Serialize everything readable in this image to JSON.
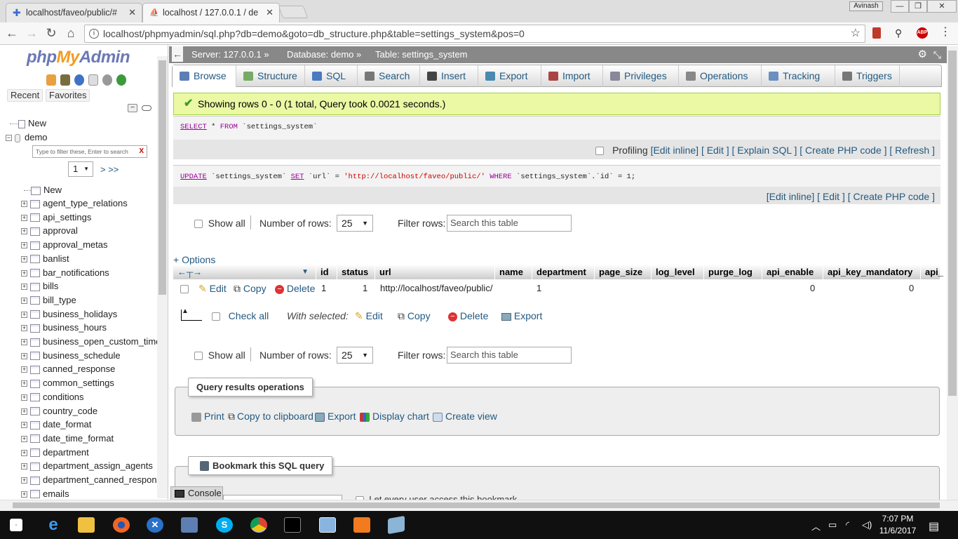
{
  "browser": {
    "tabs": [
      {
        "title": "localhost/faveo/public/#"
      },
      {
        "title": "localhost / 127.0.0.1 / de"
      }
    ],
    "user": "Avinash",
    "url": "localhost/phpmyadmin/sql.php?db=demo&goto=db_structure.php&table=settings_system&pos=0"
  },
  "sidebar": {
    "logo": {
      "php": "php",
      "my": "My",
      "admin": "Admin"
    },
    "recent": "Recent",
    "favorites": "Favorites",
    "new_root": "New",
    "db": "demo",
    "filter_placeholder": "Type to filter these, Enter to search",
    "filter_clear": "X",
    "page": "1",
    "page_next": "> >>",
    "new_table": "New",
    "tables": [
      "agent_type_relations",
      "api_settings",
      "approval",
      "approval_metas",
      "banlist",
      "bar_notifications",
      "bills",
      "bill_type",
      "business_holidays",
      "business_hours",
      "business_open_custom_time",
      "business_schedule",
      "canned_response",
      "common_settings",
      "conditions",
      "country_code",
      "date_format",
      "date_time_format",
      "department",
      "department_assign_agents",
      "department_canned_response",
      "emails"
    ]
  },
  "breadcrumb": {
    "server": "Server: 127.0.0.1",
    "database": "Database: demo",
    "table": "Table: settings_system"
  },
  "tabs": [
    "Browse",
    "Structure",
    "SQL",
    "Search",
    "Insert",
    "Export",
    "Import",
    "Privileges",
    "Operations",
    "Tracking",
    "Triggers"
  ],
  "success_message": "Showing rows 0 - 0 (1 total, Query took 0.0021 seconds.)",
  "select_query": {
    "kw1": "SELECT",
    "star": "*",
    "kw2": "FROM",
    "table": "`settings_system`"
  },
  "select_options": {
    "profiling": "Profiling",
    "edit_inline": "[Edit inline]",
    "edit": "[ Edit ]",
    "explain": "[ Explain SQL ]",
    "create_php": "[ Create PHP code ]",
    "refresh": "[ Refresh ]"
  },
  "update_query": {
    "kw1": "UPDATE",
    "t1": "`settings_system`",
    "kw2": "SET",
    "f1": "`url`",
    "eq": "=",
    "val": "'http://localhost/faveo/public/'",
    "kw3": "WHERE",
    "f2": "`settings_system`.`id`",
    "eq2": "= 1;"
  },
  "update_options": {
    "edit_inline": "[Edit inline]",
    "edit": "[ Edit ]",
    "create_php": "[ Create PHP code ]"
  },
  "nav": {
    "show_all": "Show all",
    "num_rows_label": "Number of rows:",
    "num_rows": "25",
    "filter_label": "Filter rows:",
    "filter_placeholder": "Search this table"
  },
  "options_link": "+ Options",
  "table": {
    "columns": [
      "id",
      "status",
      "url",
      "name",
      "department",
      "page_size",
      "log_level",
      "purge_log",
      "api_enable",
      "api_key_mandatory",
      "api_"
    ],
    "row": {
      "id": "1",
      "status": "1",
      "url": "http://localhost/faveo/public/",
      "name": "",
      "department": "1",
      "page_size": "",
      "log_level": "",
      "purge_log": "",
      "api_enable": "0",
      "api_key_mandatory": "0"
    },
    "row_actions": {
      "edit": "Edit",
      "copy": "Copy",
      "delete": "Delete"
    }
  },
  "bulk": {
    "check_all": "Check all",
    "with_selected": "With selected:",
    "edit": "Edit",
    "copy": "Copy",
    "delete": "Delete",
    "export": "Export"
  },
  "query_results_ops": {
    "title": "Query results operations",
    "print": "Print",
    "copy": "Copy to clipboard",
    "export": "Export",
    "chart": "Display chart",
    "view": "Create view"
  },
  "bookmark": {
    "title": "Bookmark this SQL query",
    "let_every": "Let every user access this bookmark"
  },
  "console": "Console",
  "taskbar": {
    "time": "7:07 PM",
    "date": "11/6/2017"
  }
}
